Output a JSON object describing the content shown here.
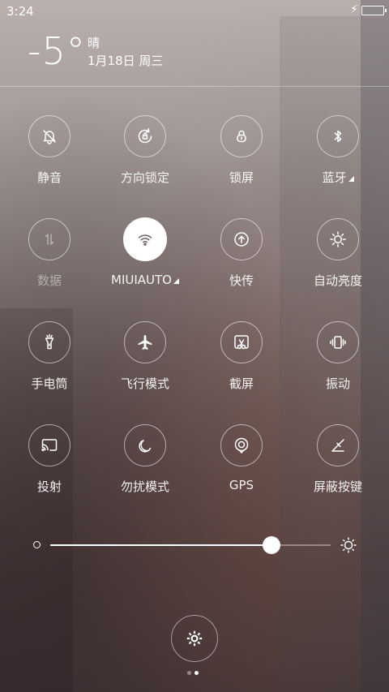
{
  "status": {
    "time": "3:24",
    "charging_icon": "bolt-icon",
    "battery_icon": "battery-icon"
  },
  "weather": {
    "temperature": "-5°",
    "condition": "晴",
    "date": "1月18日 周三"
  },
  "toggles": [
    {
      "label": "静音",
      "icon": "bell-off-icon",
      "active": false,
      "dim": false
    },
    {
      "label": "方向锁定",
      "icon": "rotation-lock-icon",
      "active": false,
      "dim": false
    },
    {
      "label": "锁屏",
      "icon": "lock-icon",
      "active": false,
      "dim": false
    },
    {
      "label": "蓝牙",
      "icon": "bluetooth-icon",
      "active": false,
      "dim": false,
      "has_menu": true
    },
    {
      "label": "数据",
      "icon": "data-arrows-icon",
      "active": false,
      "dim": true
    },
    {
      "label": "MIUIAUTO",
      "icon": "wifi-icon",
      "active": true,
      "dim": false,
      "has_menu": true
    },
    {
      "label": "快传",
      "icon": "upload-icon",
      "active": false,
      "dim": false
    },
    {
      "label": "自动亮度",
      "icon": "brightness-icon",
      "active": false,
      "dim": false
    },
    {
      "label": "手电筒",
      "icon": "flashlight-icon",
      "active": false,
      "dim": false
    },
    {
      "label": "飞行模式",
      "icon": "airplane-icon",
      "active": false,
      "dim": false
    },
    {
      "label": "截屏",
      "icon": "screenshot-icon",
      "active": false,
      "dim": false
    },
    {
      "label": "振动",
      "icon": "vibrate-icon",
      "active": false,
      "dim": false
    },
    {
      "label": "投射",
      "icon": "cast-icon",
      "active": false,
      "dim": false
    },
    {
      "label": "勿扰模式",
      "icon": "moon-icon",
      "active": false,
      "dim": false
    },
    {
      "label": "GPS",
      "icon": "gps-icon",
      "active": false,
      "dim": false
    },
    {
      "label": "屏蔽按键",
      "icon": "block-keys-icon",
      "active": false,
      "dim": false
    }
  ],
  "brightness": {
    "level": 0.79,
    "min_icon": "brightness-low-icon",
    "max_icon": "brightness-high-icon"
  },
  "settings": {
    "icon": "gear-icon"
  },
  "pager": {
    "pages": 2,
    "current": 2
  },
  "colors": {
    "accent": "#ffffff",
    "dim_text": "rgba(255,255,255,0.45)"
  }
}
